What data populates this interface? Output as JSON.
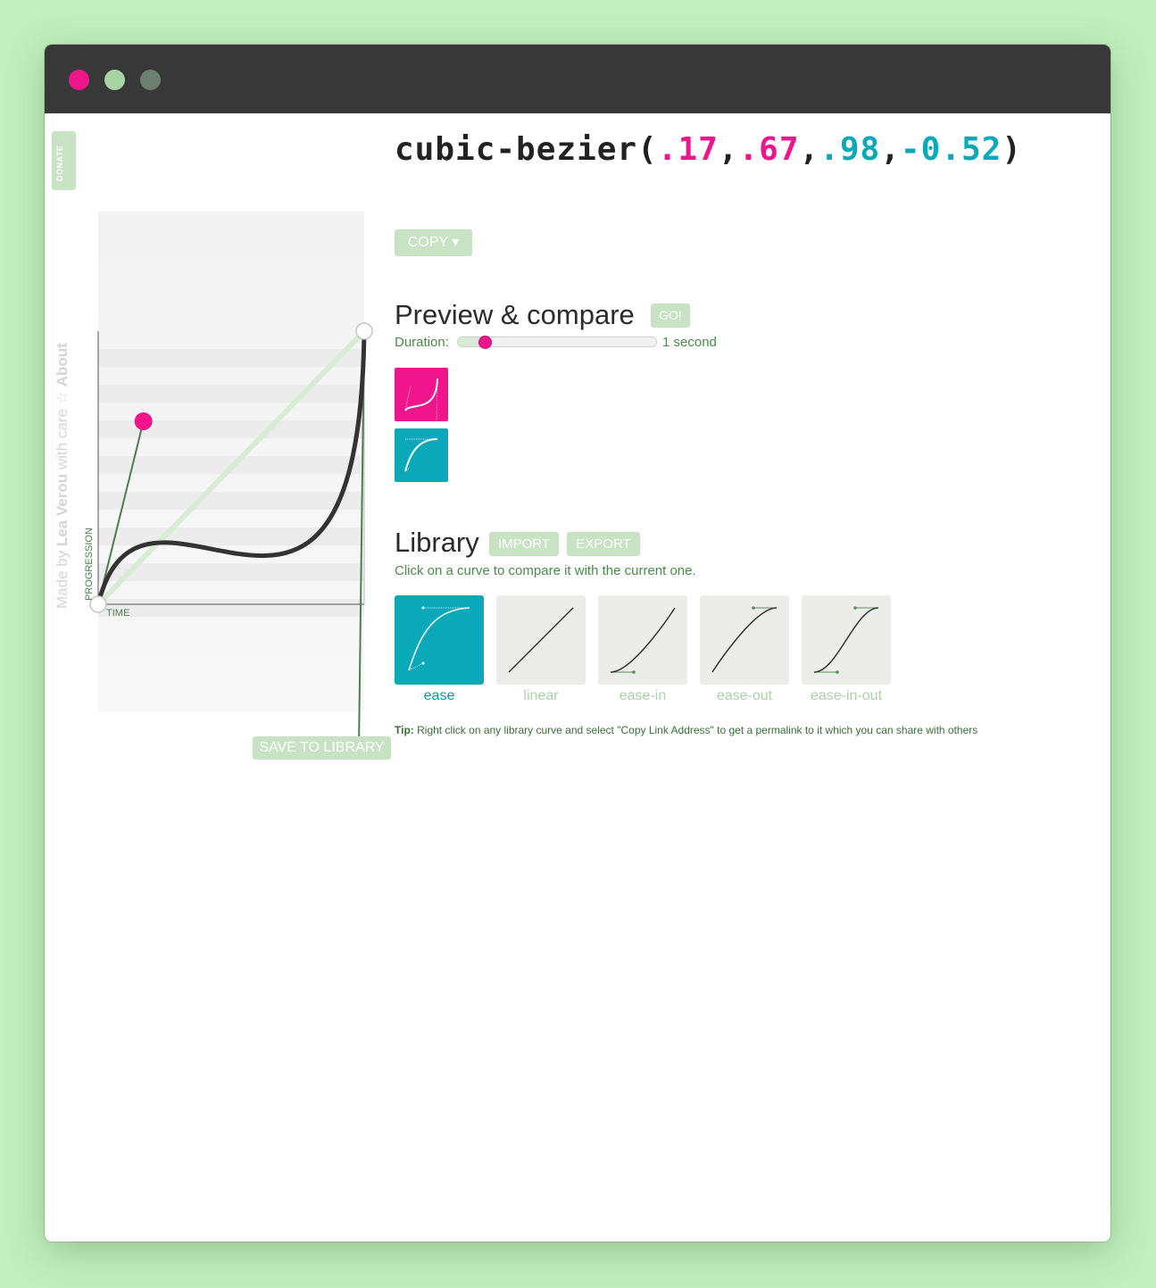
{
  "window": {
    "controls": [
      "close",
      "minimize",
      "maximize"
    ]
  },
  "sidebar": {
    "donate_label": "DONATE",
    "credit_prefix": "Made by",
    "credit_author": "Lea Verou",
    "credit_suffix": "with care",
    "star_icon": "☆",
    "about_label": "About"
  },
  "editor": {
    "y_axis_label": "PROGRESSION",
    "x_axis_label": "TIME",
    "save_button": "SAVE TO LIBRARY",
    "curve": {
      "x1": 0.17,
      "y1": 0.67,
      "x2": 0.98,
      "y2": -0.52
    }
  },
  "code": {
    "prefix": "cubic-bezier(",
    "p1x": ".17",
    "p1y": ".67",
    "p2x": ".98",
    "p2y": "-0.52",
    "sep": ",",
    "suffix": ")"
  },
  "copy_button": "COPY ▾",
  "preview": {
    "title": "Preview & compare",
    "go_button": "GO!",
    "duration_label": "Duration:",
    "duration_value": "1 second",
    "duration_fraction": 0.11
  },
  "library": {
    "title": "Library",
    "import_button": "IMPORT",
    "export_button": "EXPORT",
    "description": "Click on a curve to compare it with the current one.",
    "items": [
      {
        "name": "ease",
        "selected": true
      },
      {
        "name": "linear",
        "selected": false
      },
      {
        "name": "ease-in",
        "selected": false
      },
      {
        "name": "ease-out",
        "selected": false
      },
      {
        "name": "ease-in-out",
        "selected": false
      }
    ],
    "tip_label": "Tip:",
    "tip_text": "Right click on any library curve and select \"Copy Link Address\" to get a permalink to it which you can share with others"
  },
  "colors": {
    "accent_pink": "#f0158a",
    "accent_teal": "#0aa9ba",
    "button_green": "#c8e3c4",
    "page_bg": "#c2f0bc"
  }
}
